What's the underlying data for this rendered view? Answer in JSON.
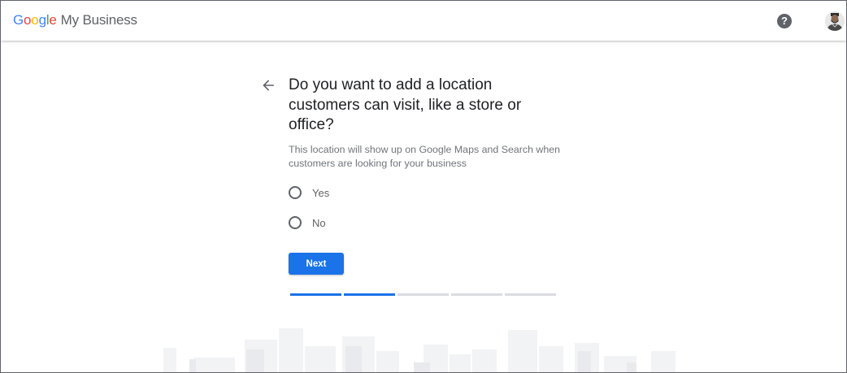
{
  "header": {
    "logo_google_letters": [
      {
        "ch": "G",
        "color": "#4285F4"
      },
      {
        "ch": "o",
        "color": "#EA4335"
      },
      {
        "ch": "o",
        "color": "#FBBC05"
      },
      {
        "ch": "g",
        "color": "#4285F4"
      },
      {
        "ch": "l",
        "color": "#34A853"
      },
      {
        "ch": "e",
        "color": "#EA4335"
      }
    ],
    "product_name": "My Business",
    "help_icon_glyph": "?"
  },
  "question": {
    "title": "Do you want to add a location customers can visit, like a store or office?",
    "subtitle": "This location will show up on Google Maps and Search when customers are looking for your business"
  },
  "options": [
    {
      "label": "Yes",
      "selected": false
    },
    {
      "label": "No",
      "selected": false
    }
  ],
  "next_button": {
    "label": "Next",
    "color": "#1a73e8"
  },
  "progress": {
    "total_steps": 5,
    "completed_steps": 2,
    "active_color": "#1a73e8",
    "inactive_color": "#dadce0"
  }
}
